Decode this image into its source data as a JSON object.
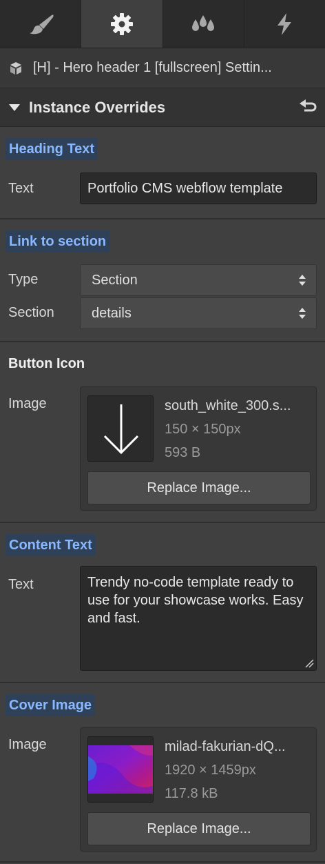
{
  "tabs": [
    {
      "icon": "brush-icon",
      "active": false
    },
    {
      "icon": "gear-icon",
      "active": true
    },
    {
      "icon": "drops-icon",
      "active": false
    },
    {
      "icon": "lightning-icon",
      "active": false
    }
  ],
  "breadcrumb": {
    "text": "[H] - Hero header 1 [fullscreen] Settin..."
  },
  "overrides": {
    "title": "Instance Overrides"
  },
  "heading_text": {
    "group_label": "Heading Text",
    "field_label": "Text",
    "value": "Portfolio CMS webflow template"
  },
  "link_section": {
    "group_label": "Link to section",
    "type_label": "Type",
    "type_value": "Section",
    "section_label": "Section",
    "section_value": "details"
  },
  "button_icon": {
    "group_label": "Button Icon",
    "field_label": "Image",
    "file_name": "south_white_300.s...",
    "dimensions": "150 × 150px",
    "size": "593 B",
    "replace_label": "Replace Image..."
  },
  "content_text": {
    "group_label": "Content Text",
    "field_label": "Text",
    "value": "Trendy no-code template ready to use for your showcase works. Easy and fast."
  },
  "cover_image": {
    "group_label": "Cover Image",
    "field_label": "Image",
    "file_name": "milad-fakurian-dQ...",
    "dimensions": "1920 × 1459px",
    "size": "117.8 kB",
    "replace_label": "Replace Image..."
  },
  "colors": {
    "panel_bg": "#404040",
    "label_chip_bg": "#2f4159",
    "label_chip_text": "#8ab8ff"
  }
}
